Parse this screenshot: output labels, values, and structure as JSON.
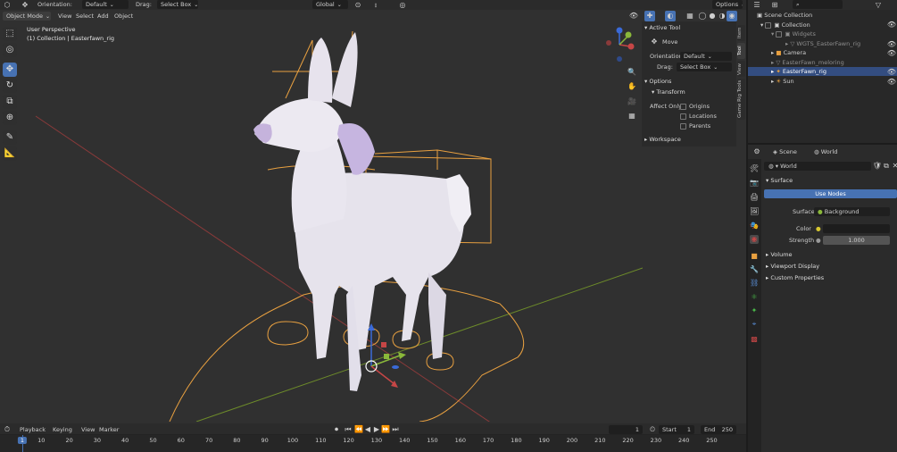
{
  "header": {
    "orientation_label": "Orientation:",
    "orientation_value": "Default",
    "drag_label": "Drag:",
    "drag_value": "Select Box",
    "transform_orientation": "Global",
    "options_label": "Options"
  },
  "viewport_header": {
    "mode": "Object Mode",
    "menus": [
      "View",
      "Select",
      "Add",
      "Object"
    ]
  },
  "viewport": {
    "perspective": "User Perspective",
    "collection_path": "(1) Collection | Easterfawn_rig"
  },
  "n_panel": {
    "active_tool_title": "Active Tool",
    "tool_name": "Move",
    "orientation_label": "Orientation",
    "orientation_value": "Default",
    "drag_label": "Drag:",
    "drag_value": "Select Box",
    "options_title": "Options",
    "transform_title": "Transform",
    "affect_only_label": "Affect Only",
    "affect_options": [
      "Origins",
      "Locations",
      "Parents"
    ],
    "workspace_title": "Workspace",
    "tabs": [
      "Item",
      "Tool",
      "View",
      "Game Rig Tools"
    ]
  },
  "outliner": {
    "items": [
      {
        "label": "Scene Collection"
      },
      {
        "label": "Collection"
      },
      {
        "label": "Widgets"
      },
      {
        "label": "WGTS_EasterFawn_rig"
      },
      {
        "label": "Camera"
      },
      {
        "label": "EasterFawn_meloring"
      },
      {
        "label": "EasterFawn_rig"
      },
      {
        "label": "Sun"
      }
    ]
  },
  "properties": {
    "scene_label": "Scene",
    "world_label": "World",
    "world_name": "World",
    "surface_title": "Surface",
    "use_nodes_label": "Use Nodes",
    "surface_label": "Surface",
    "surface_value": "Background",
    "color_label": "Color",
    "strength_label": "Strength",
    "strength_value": "1.000",
    "volume_title": "Volume",
    "viewport_display_title": "Viewport Display",
    "custom_properties_title": "Custom Properties"
  },
  "timeline": {
    "menus": [
      "Playback",
      "Keying",
      "View",
      "Marker"
    ],
    "current_frame": "1",
    "start_label": "Start",
    "start_value": "1",
    "end_label": "End",
    "end_value": "250",
    "ruler_ticks": [
      "1",
      "10",
      "20",
      "30",
      "40",
      "50",
      "60",
      "70",
      "80",
      "90",
      "100",
      "110",
      "120",
      "130",
      "140",
      "150",
      "160",
      "170",
      "180",
      "190",
      "200",
      "210",
      "220",
      "230",
      "240",
      "250"
    ]
  },
  "colors": {
    "accent_blue": "#4772b3",
    "selection_orange": "#e8a040",
    "axis_red": "#c64646",
    "axis_green": "#8ab83a",
    "background": "#303030"
  }
}
